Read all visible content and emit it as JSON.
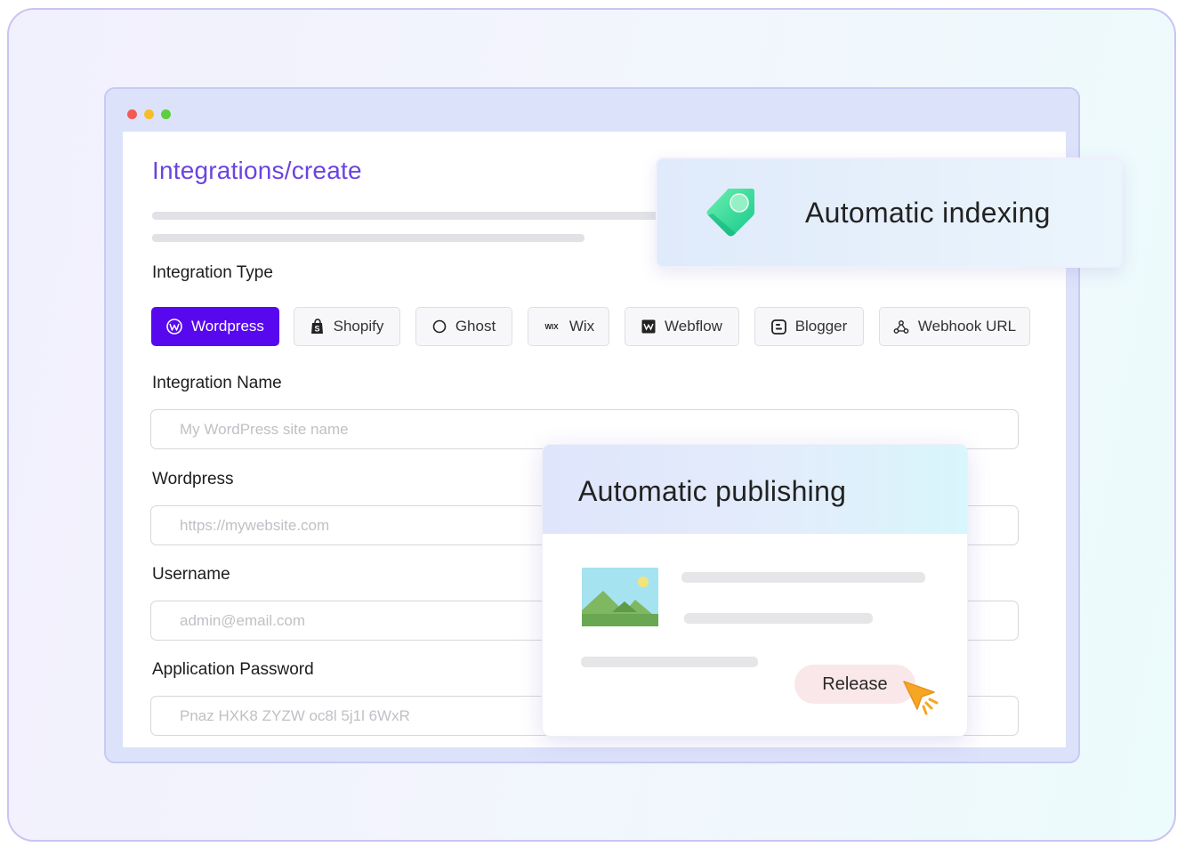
{
  "page": {
    "title": "Integrations/create"
  },
  "form": {
    "integration_type_label": "Integration Type",
    "integration_types": [
      {
        "label": "Wordpress",
        "icon": "wordpress-icon",
        "active": true
      },
      {
        "label": "Shopify",
        "icon": "shopify-icon",
        "active": false
      },
      {
        "label": "Ghost",
        "icon": "ghost-icon",
        "active": false
      },
      {
        "label": "Wix",
        "icon": "wix-icon",
        "active": false
      },
      {
        "label": "Webflow",
        "icon": "webflow-icon",
        "active": false
      },
      {
        "label": "Blogger",
        "icon": "blogger-icon",
        "active": false
      },
      {
        "label": "Webhook URL",
        "icon": "webhook-icon",
        "active": false
      }
    ],
    "integration_name": {
      "label": "Integration Name",
      "placeholder": "My WordPress site name",
      "value": ""
    },
    "wordpress_url": {
      "label": "Wordpress",
      "placeholder": "https://mywebsite.com",
      "value": ""
    },
    "username": {
      "label": "Username",
      "placeholder": "admin@email.com",
      "value": ""
    },
    "app_password": {
      "label": "Application Password",
      "placeholder": "Pnaz HXK8 ZYZW oc8l 5j1l 6WxR",
      "value": ""
    }
  },
  "cards": {
    "indexing": {
      "title": "Automatic indexing",
      "icon": "tag-icon"
    },
    "publishing": {
      "title": "Automatic publishing",
      "release_label": "Release",
      "thumbnail": "image-placeholder-icon",
      "cursor": "cursor-icon"
    }
  },
  "colors": {
    "accent": "#5808ef",
    "title": "#6a44e0",
    "release_bg": "#f9e7e9",
    "window_red": "#f45a55",
    "window_yellow": "#f7bd2c",
    "window_green": "#5ccf3f"
  }
}
